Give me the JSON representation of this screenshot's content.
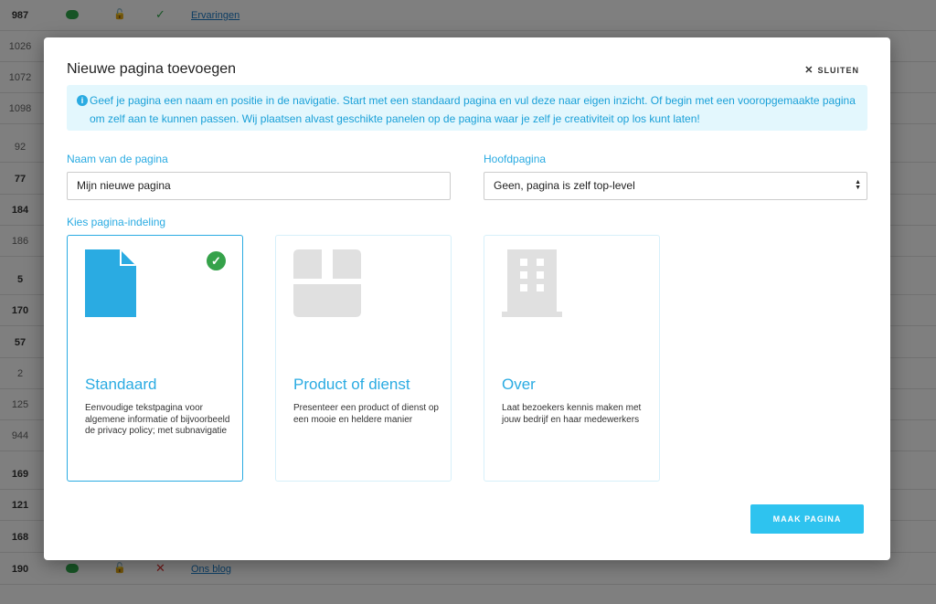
{
  "background": {
    "rows": [
      {
        "num": "987",
        "status": "✓",
        "status_type": "ok",
        "link": "Ervaringen"
      },
      {
        "num": "1026",
        "light": true
      },
      {
        "num": "1072",
        "light": true
      },
      {
        "num": "1098",
        "light": true
      },
      {
        "num": "92",
        "light": true
      },
      {
        "num": "77"
      },
      {
        "num": "184"
      },
      {
        "num": "186",
        "light": true
      },
      {
        "num": "5"
      },
      {
        "num": "170"
      },
      {
        "num": "57"
      },
      {
        "num": "2",
        "light": true
      },
      {
        "num": "125",
        "light": true
      },
      {
        "num": "944",
        "light": true
      },
      {
        "num": "169"
      },
      {
        "num": "121"
      },
      {
        "num": "168"
      },
      {
        "num": "190",
        "status": "✕",
        "status_type": "no",
        "link": "Ons blog"
      }
    ]
  },
  "modal": {
    "title": "Nieuwe pagina toevoegen",
    "close_label": "SLUITEN",
    "info_text": "Geef je pagina een naam en positie in de navigatie. Start met een standaard pagina en vul deze naar eigen inzicht. Of begin met een vooropgemaakte pagina om zelf aan te kunnen passen. Wij plaatsen alvast geschikte panelen op de pagina waar je zelf je creativiteit op los kunt laten!",
    "name_label": "Naam van de pagina",
    "name_value": "Mijn nieuwe pagina",
    "parent_label": "Hoofdpagina",
    "parent_value": "Geen, pagina is zelf top-level",
    "layout_label": "Kies pagina-indeling",
    "cards": [
      {
        "title": "Standaard",
        "desc": "Eenvoudige tekstpagina voor algemene informatie of bijvoorbeeld de privacy policy; met subnavigatie",
        "icon": "document-icon",
        "selected": true
      },
      {
        "title": "Product of dienst",
        "desc": "Presenteer een product of dienst op een mooie en heldere manier",
        "icon": "box-icon",
        "selected": false
      },
      {
        "title": "Over",
        "desc": "Laat bezoekers kennis maken met jouw bedrijf en haar medewerkers",
        "icon": "building-icon",
        "selected": false
      }
    ],
    "submit_label": "MAAK PAGINA"
  },
  "colors": {
    "accent": "#2aabe2",
    "button": "#2ec3ef",
    "success": "#35a24a",
    "info_bg": "#e3f7fd"
  }
}
